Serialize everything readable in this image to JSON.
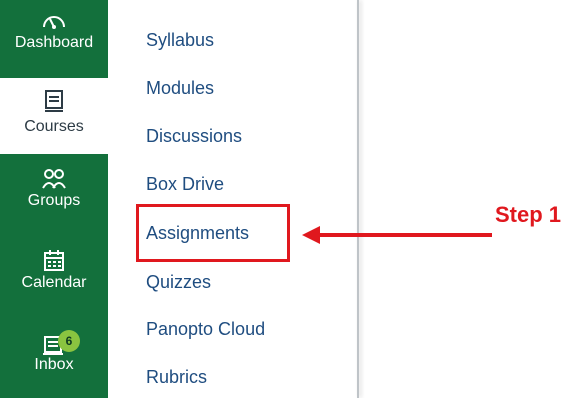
{
  "global_nav": {
    "items": [
      {
        "label": "Dashboard",
        "icon": "dashboard-icon",
        "active": false
      },
      {
        "label": "Courses",
        "icon": "courses-icon",
        "active": true
      },
      {
        "label": "Groups",
        "icon": "groups-icon",
        "active": false
      },
      {
        "label": "Calendar",
        "icon": "calendar-icon",
        "active": false
      },
      {
        "label": "Inbox",
        "icon": "inbox-icon",
        "active": false,
        "badge": "6"
      }
    ]
  },
  "course_nav": {
    "links": [
      "Syllabus",
      "Modules",
      "Discussions",
      "Box Drive",
      "Assignments",
      "Quizzes",
      "Panopto Cloud",
      "Rubrics"
    ]
  },
  "annotation": {
    "step_label": "Step 1",
    "highlighted_link": "Assignments"
  },
  "colors": {
    "nav_green": "#13703c",
    "link_blue": "#1f4d80",
    "annotation_red": "#e0181e",
    "badge_green": "#8ac440"
  }
}
